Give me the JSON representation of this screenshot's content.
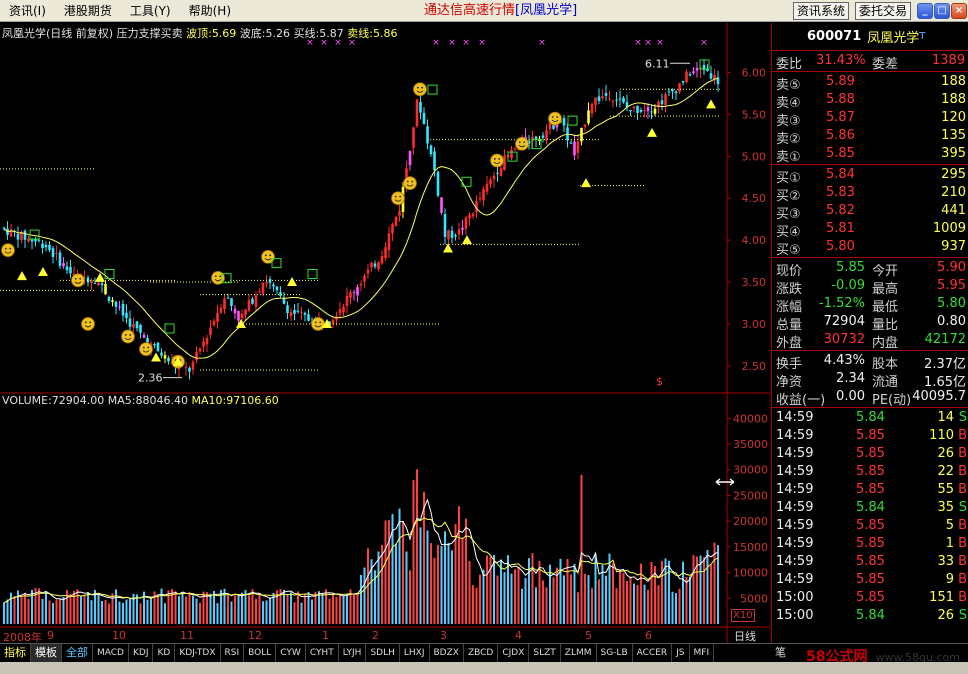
{
  "menu": {
    "items": [
      "资讯(I)",
      "港股期货",
      "工具(Y)",
      "帮助(H)"
    ],
    "title_main": "通达信高速行情",
    "title_sub": "[凤凰光学]",
    "btn_news": "资讯系统",
    "btn_trade": "委托交易"
  },
  "chart": {
    "name": "凤凰光学(日线 前复权)",
    "indicator": "压力支撑买卖",
    "peak_label": "波顶:",
    "peak": "5.69",
    "trough_label": "波底:",
    "trough": "5.26",
    "buy_label": "买线:",
    "buy": "5.87",
    "sell_label": "卖线:",
    "sell": "5.86",
    "high_mark": "6.11",
    "low_mark": "2.36",
    "volume_label": "VOLUME:",
    "volume": "72904.00",
    "ma5_label": "MA5:",
    "ma5": "88046.40",
    "ma10_label": "MA10:",
    "ma10": "97106.60",
    "x10": "X10",
    "period": "日线",
    "dollar": "$",
    "colors": {
      "up": "#ff2a2a",
      "down": "#33e6ff",
      "yellow": "#ffff33",
      "magenta": "#ff55ff",
      "green": "#33dd33",
      "grid": "#aa0000"
    }
  },
  "chart_data": {
    "type": "candlestick",
    "price_ticks": [
      "6.00",
      "5.50",
      "5.00",
      "4.50",
      "4.00",
      "3.50",
      "3.00",
      "2.50"
    ],
    "price_ylim": [
      2.2,
      6.4
    ],
    "volume_ticks": [
      "40000",
      "35000",
      "30000",
      "25000",
      "20000",
      "15000",
      "10000",
      "5000"
    ],
    "volume_ylim": [
      0,
      42000
    ],
    "x_labels": [
      "2008年",
      "9",
      "10",
      "11",
      "12",
      "1",
      "2",
      "3",
      "4",
      "5",
      "6"
    ],
    "high": 6.11,
    "low": 2.36
  },
  "panel": {
    "code": "600071",
    "name": "凤凰光学",
    "t": "T",
    "weibi_label": "委比",
    "weibi": "31.43%",
    "weicha_label": "委差",
    "weicha": "1389",
    "asks": [
      {
        "label": "卖⑤",
        "price": "5.89",
        "vol": "188"
      },
      {
        "label": "卖④",
        "price": "5.88",
        "vol": "188"
      },
      {
        "label": "卖③",
        "price": "5.87",
        "vol": "120"
      },
      {
        "label": "卖②",
        "price": "5.86",
        "vol": "135"
      },
      {
        "label": "卖①",
        "price": "5.85",
        "vol": "395"
      }
    ],
    "bids": [
      {
        "label": "买①",
        "price": "5.84",
        "vol": "295"
      },
      {
        "label": "买②",
        "price": "5.83",
        "vol": "210"
      },
      {
        "label": "买③",
        "price": "5.82",
        "vol": "441"
      },
      {
        "label": "买④",
        "price": "5.81",
        "vol": "1009"
      },
      {
        "label": "买⑤",
        "price": "5.80",
        "vol": "937"
      }
    ],
    "stats": [
      {
        "l1": "现价",
        "v1": "5.85",
        "c1": "grn",
        "l2": "今开",
        "v2": "5.90",
        "c2": "red"
      },
      {
        "l1": "涨跌",
        "v1": "-0.09",
        "c1": "grn",
        "l2": "最高",
        "v2": "5.95",
        "c2": "red"
      },
      {
        "l1": "涨幅",
        "v1": "-1.52%",
        "c1": "grn",
        "l2": "最低",
        "v2": "5.80",
        "c2": "grn"
      },
      {
        "l1": "总量",
        "v1": "72904",
        "c1": "wht",
        "l2": "量比",
        "v2": "0.80",
        "c2": "wht"
      },
      {
        "l1": "外盘",
        "v1": "30732",
        "c1": "red",
        "l2": "内盘",
        "v2": "42172",
        "c2": "grn"
      }
    ],
    "fund": [
      {
        "l1": "换手",
        "v1": "4.43%",
        "l2": "股本",
        "v2": "2.37亿"
      },
      {
        "l1": "净资",
        "v1": "2.34",
        "l2": "流通",
        "v2": "1.65亿"
      },
      {
        "l1": "收益(一)",
        "v1": "0.00",
        "l2": "PE(动)",
        "v2": "40095.7"
      }
    ],
    "ticks": [
      {
        "time": "14:59",
        "price": "5.84",
        "vol": "14",
        "dir": "S"
      },
      {
        "time": "14:59",
        "price": "5.85",
        "vol": "110",
        "dir": "B"
      },
      {
        "time": "14:59",
        "price": "5.85",
        "vol": "26",
        "dir": "B"
      },
      {
        "time": "14:59",
        "price": "5.85",
        "vol": "22",
        "dir": "B"
      },
      {
        "time": "14:59",
        "price": "5.85",
        "vol": "55",
        "dir": "B"
      },
      {
        "time": "14:59",
        "price": "5.84",
        "vol": "35",
        "dir": "S"
      },
      {
        "time": "14:59",
        "price": "5.85",
        "vol": "5",
        "dir": "B"
      },
      {
        "time": "14:59",
        "price": "5.85",
        "vol": "1",
        "dir": "B"
      },
      {
        "time": "14:59",
        "price": "5.85",
        "vol": "33",
        "dir": "B"
      },
      {
        "time": "14:59",
        "price": "5.85",
        "vol": "9",
        "dir": "B"
      },
      {
        "time": "15:00",
        "price": "5.85",
        "vol": "151",
        "dir": "B"
      },
      {
        "time": "15:00",
        "price": "5.84",
        "vol": "26",
        "dir": "S"
      }
    ]
  },
  "tabs": {
    "items": [
      "指标",
      "模板",
      "全部",
      "MACD",
      "KDJ",
      "KD",
      "KDJ-TDX",
      "RSI",
      "BOLL",
      "CYW",
      "CYHT",
      "LYJH",
      "SDLH",
      "LHXJ",
      "BDZX",
      "ZBCD",
      "CJDX",
      "SLZT",
      "ZLMM",
      "SG-LB",
      "ACCER",
      "JS",
      "MFI"
    ],
    "right": "笔"
  },
  "watermark": {
    "logo": "58公式网",
    "url": "www.58gu.com"
  }
}
